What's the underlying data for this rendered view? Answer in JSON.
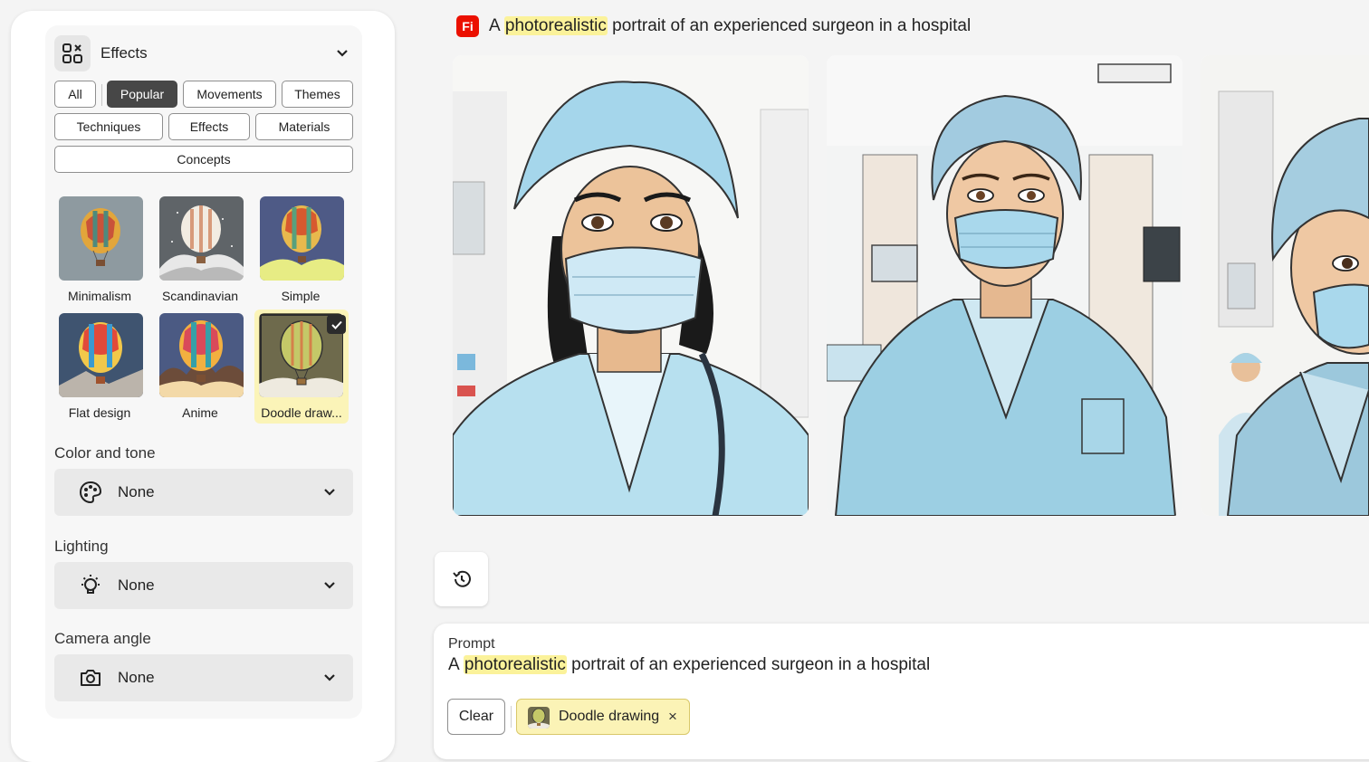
{
  "effects": {
    "title": "Effects",
    "chips": [
      {
        "label": "All",
        "selected": false
      },
      {
        "label": "Popular",
        "selected": true
      },
      {
        "label": "Movements",
        "selected": false
      },
      {
        "label": "Themes",
        "selected": false
      },
      {
        "label": "Techniques",
        "selected": false
      },
      {
        "label": "Effects",
        "selected": false
      },
      {
        "label": "Materials",
        "selected": false
      },
      {
        "label": "Concepts",
        "selected": false
      }
    ],
    "styles": [
      {
        "label": "Minimalism",
        "selected": false
      },
      {
        "label": "Scandinavian",
        "selected": false
      },
      {
        "label": "Simple",
        "selected": false
      },
      {
        "label": "Flat design",
        "selected": false
      },
      {
        "label": "Anime",
        "selected": false
      },
      {
        "label": "Doodle draw...",
        "selected": true
      }
    ]
  },
  "color_tone": {
    "label": "Color and tone",
    "value": "None",
    "icon": "palette-icon"
  },
  "lighting": {
    "label": "Lighting",
    "value": "None",
    "icon": "lightbulb-icon"
  },
  "camera_angle": {
    "label": "Camera angle",
    "value": "None",
    "icon": "camera-icon"
  },
  "header": {
    "badge": "Fi",
    "prompt_before": "A ",
    "prompt_highlight": "photorealistic",
    "prompt_after": " portrait of an experienced surgeon in a hospital"
  },
  "prompt_panel": {
    "label": "Prompt",
    "text_before": "A ",
    "text_highlight": "photorealistic",
    "text_after": " portrait of an experienced surgeon in a hospital",
    "clear_label": "Clear",
    "tag_label": "Doodle drawing",
    "tag_remove": "×"
  },
  "colors": {
    "accent_red": "#eb1000",
    "highlight": "#fbf29a",
    "selected_chip": "#474747",
    "scrub_blue": "#a9d9ec"
  }
}
